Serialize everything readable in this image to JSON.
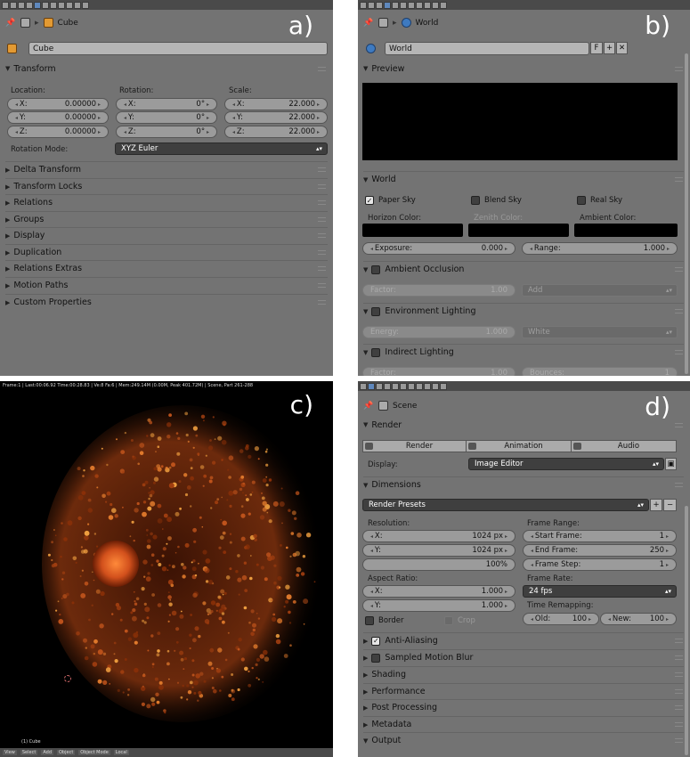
{
  "a": {
    "letter": "a)",
    "context": "Cube",
    "name": "Cube",
    "transform": "Transform",
    "location": {
      "label": "Location:",
      "x": "X:",
      "y": "Y:",
      "z": "Z:",
      "xv": "0.00000",
      "yv": "0.00000",
      "zv": "0.00000"
    },
    "rotation": {
      "label": "Rotation:",
      "x": "X:",
      "y": "Y:",
      "z": "Z:",
      "xv": "0°",
      "yv": "0°",
      "zv": "0°"
    },
    "scale": {
      "label": "Scale:",
      "x": "X:",
      "y": "Y:",
      "z": "Z:",
      "xv": "22.000",
      "yv": "22.000",
      "zv": "22.000"
    },
    "rotation_mode": "Rotation Mode:",
    "rotation_mode_value": "XYZ Euler",
    "sections": [
      "Delta Transform",
      "Transform Locks",
      "Relations",
      "Groups",
      "Display",
      "Duplication",
      "Relations Extras",
      "Motion Paths",
      "Custom Properties"
    ]
  },
  "b": {
    "letter": "b)",
    "context": "World",
    "name": "World",
    "fake": "F",
    "preview": "Preview",
    "world": "World",
    "paper_sky": "Paper Sky",
    "blend_sky": "Blend Sky",
    "real_sky": "Real Sky",
    "horizon": "Horizon Color:",
    "zenith": "Zenith Color:",
    "ambient": "Ambient Color:",
    "exposure": "Exposure:",
    "exposure_v": "0.000",
    "range": "Range:",
    "range_v": "1.000",
    "ao": "Ambient Occlusion",
    "factor": "Factor:",
    "factor_v": "1.00",
    "add": "Add",
    "env": "Environment Lighting",
    "energy": "Energy:",
    "energy_v": "1.000",
    "white": "White",
    "indirect": "Indirect Lighting",
    "factor2": "Factor:",
    "factor2_v": "1.00",
    "bounces": "Bounces:",
    "bounces_v": "1"
  },
  "c": {
    "letter": "c)",
    "info": "Frame:1 | Last:00:06.92 Time:00:28.83 | Ve:8 Fa:6 | Mem:249.14M (0.00M, Peak 401.72M) | Scene, Part 261-288",
    "cube": "(1) Cube",
    "footer": [
      "View",
      "Select",
      "Add",
      "Object",
      "Object Mode",
      "Local"
    ]
  },
  "d": {
    "letter": "d)",
    "context": "Scene",
    "render": "Render",
    "render_btn": "Render",
    "animation_btn": "Animation",
    "audio_btn": "Audio",
    "display": "Display:",
    "display_v": "Image Editor",
    "dimensions": "Dimensions",
    "presets": "Render Presets",
    "resolution": "Resolution:",
    "rx": "X:",
    "rx_v": "1024 px",
    "ry": "Y:",
    "ry_v": "1024 px",
    "pct": "100%",
    "frame_range": "Frame Range:",
    "start": "Start Frame:",
    "start_v": "1",
    "end": "End Frame:",
    "end_v": "250",
    "step": "Frame Step:",
    "step_v": "1",
    "aspect": "Aspect Ratio:",
    "ax": "X:",
    "ax_v": "1.000",
    "ay": "Y:",
    "ay_v": "1.000",
    "frame_rate": "Frame Rate:",
    "fps": "24 fps",
    "border": "Border",
    "crop": "Crop",
    "remap": "Time Remapping:",
    "old": "Old:",
    "old_v": "100",
    "new": "New:",
    "new_v": "100",
    "sections": [
      "Anti-Aliasing",
      "Sampled Motion Blur",
      "Shading",
      "Performance",
      "Post Processing",
      "Metadata",
      "Output"
    ]
  }
}
